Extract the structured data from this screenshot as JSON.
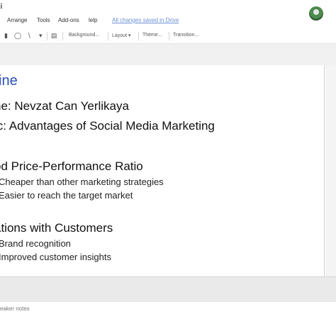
{
  "menubar": {
    "doc_icon": "ℹ",
    "items": [
      {
        "label": "Arrange"
      },
      {
        "label": "Tools"
      },
      {
        "label": "Add-ons"
      },
      {
        "label": "lelp"
      }
    ],
    "saved_status": "All changes saved in Drive",
    "avatar_icon": "user-avatar"
  },
  "toolbar": {
    "background_label": "Background...",
    "layout_label": "Layout ▾",
    "theme_label": "Theme...",
    "transition_label": "Transition..."
  },
  "slide": {
    "title": "tline",
    "name_line": "ne: Nevzat Can Yerlikaya",
    "topic_line": "ic: Advantages of Social Media Marketing",
    "section1": {
      "heading": "od Price-Performance Ratio",
      "bullets": [
        "Cheaper than other marketing strategies",
        "Easier to reach the target market"
      ]
    },
    "section2": {
      "heading": "ations with Customers",
      "bullets": [
        "Brand recognition",
        "Improved customer insights"
      ]
    }
  },
  "notes": {
    "placeholder": "eaker notes"
  }
}
